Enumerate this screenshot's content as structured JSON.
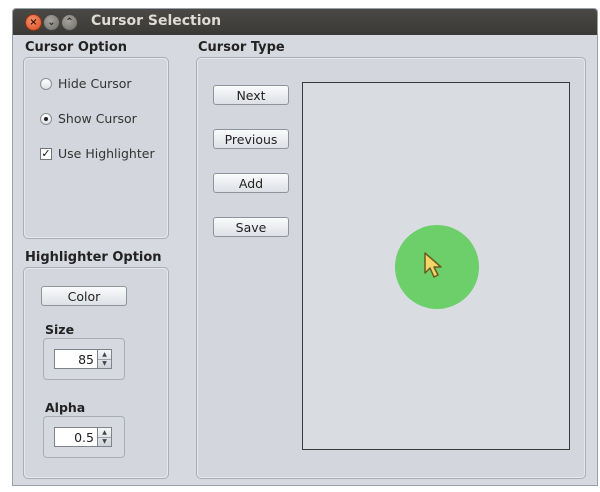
{
  "window": {
    "title": "Cursor Selection"
  },
  "colors": {
    "highlighter": "#6ccf6a",
    "cursor_fill": "#f2d66a",
    "cursor_stroke": "#6b5a1c",
    "titlebar": "#3e3d39"
  },
  "cursor_option": {
    "label": "Cursor Option",
    "hide_label": "Hide Cursor",
    "show_label": "Show Cursor",
    "highlighter_label": "Use Highlighter",
    "selected": "Show Cursor",
    "use_highlighter": true
  },
  "highlighter_option": {
    "label": "Highlighter Option",
    "color_button": "Color",
    "size_label": "Size",
    "size_value": "85",
    "alpha_label": "Alpha",
    "alpha_value": "0.5"
  },
  "cursor_type": {
    "label": "Cursor Type",
    "next": "Next",
    "previous": "Previous",
    "add": "Add",
    "save": "Save"
  },
  "icons": {
    "close": "close-icon",
    "minimize": "minimize-icon",
    "maximize": "maximize-icon",
    "cursor": "arrow-cursor-icon"
  }
}
